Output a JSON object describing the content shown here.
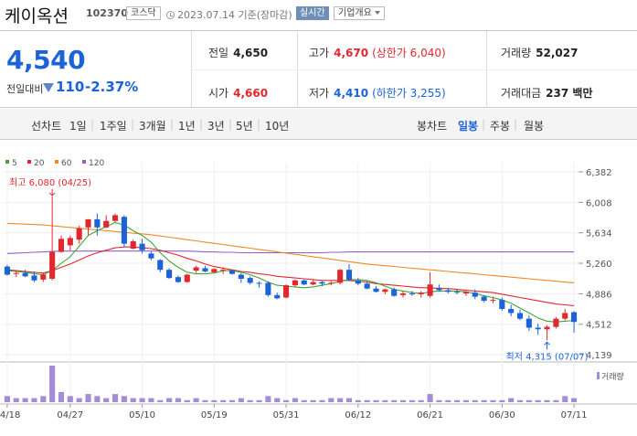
{
  "header": {
    "stock_name": "케이옥션",
    "stock_code": "102370",
    "market_badge": "코스닥",
    "as_of": "2023.07.14 기준(장마감)",
    "realtime_button": "실시간",
    "company_button": "기업개요"
  },
  "quote": {
    "current_price": "4,540",
    "change_label": "전일대비",
    "change_value": "110",
    "change_percent": "-2.37%",
    "prev_close": {
      "label": "전일",
      "value": "4,650"
    },
    "open": {
      "label": "시가",
      "value": "4,660"
    },
    "high": {
      "label": "고가",
      "value": "4,670",
      "limit_text": "(상한가 6,040)"
    },
    "low": {
      "label": "저가",
      "value": "4,410",
      "limit_text": "(하한가 3,255)"
    },
    "volume": {
      "label": "거래량",
      "value": "52,027"
    },
    "trade_value": {
      "label": "거래대금",
      "value": "237 백만"
    }
  },
  "period_bar": {
    "line_chart_label": "선차트",
    "line_periods": [
      "1일",
      "1주일",
      "3개월",
      "1년",
      "3년",
      "5년",
      "10년"
    ],
    "candle_chart_label": "봉차트",
    "candle_periods": [
      "일봉",
      "주봉",
      "월봉"
    ],
    "selected_candle_period": "일봉"
  },
  "colors": {
    "up": "#e0282e",
    "down": "#1b63d6",
    "ma5": "#3fa535",
    "ma20": "#e0282e",
    "ma60": "#f08a24",
    "ma120": "#9b59d0",
    "volume": "#a38cd8"
  },
  "chart_data": {
    "type": "candlestick",
    "legend": [
      {
        "name": "5",
        "color": "#3fa535"
      },
      {
        "name": "20",
        "color": "#e0282e"
      },
      {
        "name": "60",
        "color": "#f08a24"
      },
      {
        "name": "120",
        "color": "#9b59d0"
      }
    ],
    "volume_legend": "거래량",
    "y_ticks": [
      "6,382",
      "6,008",
      "5,634",
      "5,260",
      "4,886",
      "4,512",
      "4,139"
    ],
    "y_tick_values": [
      6382,
      6008,
      5634,
      5260,
      4886,
      4512,
      4139
    ],
    "ylim": [
      4139,
      6382
    ],
    "x_ticks": [
      "04/18",
      "04/27",
      "05/10",
      "05/19",
      "05/31",
      "06/12",
      "06/21",
      "06/30",
      "07/11"
    ],
    "x_tick_index": [
      0,
      7,
      15,
      23,
      31,
      39,
      47,
      55,
      63
    ],
    "annotations": {
      "high": {
        "text": "최고 6,080 (04/25)",
        "index": 5,
        "value": 6080
      },
      "low": {
        "text": "최저 4,315 (07/07)",
        "index": 60,
        "value": 4315
      }
    },
    "candles": [
      [
        5220,
        5240,
        5110,
        5120
      ],
      [
        5130,
        5170,
        5090,
        5140
      ],
      [
        5140,
        5180,
        5090,
        5100
      ],
      [
        5110,
        5160,
        5030,
        5050
      ],
      [
        5060,
        5140,
        5030,
        5120
      ],
      [
        5070,
        6080,
        5050,
        5400
      ],
      [
        5400,
        5600,
        5390,
        5560
      ],
      [
        5480,
        5600,
        5420,
        5570
      ],
      [
        5550,
        5720,
        5500,
        5690
      ],
      [
        5700,
        5800,
        5600,
        5800
      ],
      [
        5800,
        5870,
        5600,
        5700
      ],
      [
        5700,
        5850,
        5690,
        5780
      ],
      [
        5780,
        5870,
        5760,
        5850
      ],
      [
        5830,
        5850,
        5460,
        5500
      ],
      [
        5440,
        5550,
        5430,
        5530
      ],
      [
        5500,
        5560,
        5380,
        5420
      ],
      [
        5380,
        5400,
        5300,
        5320
      ],
      [
        5300,
        5310,
        5150,
        5180
      ],
      [
        5180,
        5200,
        5070,
        5080
      ],
      [
        5090,
        5110,
        5020,
        5030
      ],
      [
        5030,
        5130,
        5020,
        5120
      ],
      [
        5170,
        5230,
        5140,
        5210
      ],
      [
        5200,
        5230,
        5150,
        5160
      ],
      [
        5150,
        5200,
        5140,
        5190
      ],
      [
        5180,
        5210,
        5130,
        5180
      ],
      [
        5170,
        5180,
        5120,
        5130
      ],
      [
        5120,
        5140,
        5020,
        5070
      ],
      [
        5080,
        5100,
        5000,
        5020
      ],
      [
        5020,
        5040,
        4960,
        5010
      ],
      [
        5020,
        5040,
        4850,
        4870
      ],
      [
        4870,
        4900,
        4820,
        4830
      ],
      [
        4840,
        5000,
        4830,
        4990
      ],
      [
        4990,
        5060,
        4970,
        5050
      ],
      [
        5050,
        5060,
        4990,
        5000
      ],
      [
        5000,
        5060,
        4990,
        5030
      ],
      [
        5030,
        5040,
        4980,
        5010
      ],
      [
        5010,
        5040,
        4990,
        5020
      ],
      [
        5020,
        5190,
        5000,
        5180
      ],
      [
        5180,
        5250,
        5040,
        5060
      ],
      [
        5050,
        5080,
        4990,
        5010
      ],
      [
        5010,
        5040,
        4940,
        4950
      ],
      [
        4950,
        4980,
        4900,
        4910
      ],
      [
        4910,
        4950,
        4880,
        4940
      ],
      [
        4940,
        4960,
        4850,
        4860
      ],
      [
        4870,
        4920,
        4840,
        4890
      ],
      [
        4890,
        4920,
        4860,
        4880
      ],
      [
        4880,
        4920,
        4840,
        4900
      ],
      [
        4860,
        5150,
        4840,
        5000
      ],
      [
        4960,
        5000,
        4920,
        4930
      ],
      [
        4930,
        4960,
        4890,
        4910
      ],
      [
        4910,
        4940,
        4880,
        4900
      ],
      [
        4890,
        4920,
        4860,
        4910
      ],
      [
        4900,
        4940,
        4820,
        4850
      ],
      [
        4850,
        4870,
        4780,
        4800
      ],
      [
        4800,
        4850,
        4770,
        4810
      ],
      [
        4810,
        4840,
        4680,
        4700
      ],
      [
        4700,
        4750,
        4610,
        4650
      ],
      [
        4650,
        4690,
        4560,
        4580
      ],
      [
        4580,
        4620,
        4430,
        4470
      ],
      [
        4470,
        4520,
        4380,
        4450
      ],
      [
        4450,
        4500,
        4315,
        4480
      ],
      [
        4480,
        4600,
        4460,
        4580
      ],
      [
        4580,
        4700,
        4560,
        4650
      ],
      [
        4660,
        4670,
        4410,
        4540
      ]
    ],
    "ma5": [
      5170,
      5160,
      5150,
      5130,
      5120,
      5170,
      5260,
      5340,
      5470,
      5600,
      5660,
      5710,
      5760,
      5730,
      5660,
      5600,
      5520,
      5390,
      5290,
      5210,
      5150,
      5130,
      5130,
      5140,
      5170,
      5170,
      5150,
      5120,
      5080,
      5030,
      4990,
      4980,
      4970,
      4960,
      4970,
      4990,
      5010,
      5040,
      5060,
      5060,
      5050,
      5020,
      4980,
      4940,
      4920,
      4900,
      4890,
      4910,
      4920,
      4920,
      4920,
      4910,
      4890,
      4860,
      4840,
      4810,
      4770,
      4710,
      4650,
      4590,
      4550,
      4540,
      4550,
      4560
    ],
    "ma20": [
      5180,
      5170,
      5160,
      5150,
      5140,
      5170,
      5210,
      5250,
      5300,
      5350,
      5390,
      5420,
      5450,
      5460,
      5460,
      5450,
      5440,
      5420,
      5390,
      5360,
      5320,
      5290,
      5250,
      5220,
      5200,
      5180,
      5160,
      5150,
      5130,
      5120,
      5100,
      5090,
      5080,
      5070,
      5060,
      5050,
      5050,
      5050,
      5050,
      5040,
      5030,
      5010,
      5000,
      4990,
      4980,
      4970,
      4960,
      4960,
      4950,
      4950,
      4940,
      4930,
      4920,
      4910,
      4900,
      4880,
      4860,
      4840,
      4820,
      4800,
      4780,
      4760,
      4750,
      4740
    ],
    "ma60": [
      5750,
      5745,
      5740,
      5735,
      5730,
      5720,
      5710,
      5700,
      5690,
      5680,
      5670,
      5660,
      5650,
      5640,
      5630,
      5620,
      5610,
      5595,
      5580,
      5565,
      5550,
      5535,
      5520,
      5505,
      5490,
      5475,
      5460,
      5445,
      5430,
      5415,
      5400,
      5385,
      5370,
      5355,
      5340,
      5325,
      5310,
      5295,
      5280,
      5265,
      5250,
      5240,
      5230,
      5220,
      5210,
      5200,
      5190,
      5180,
      5170,
      5160,
      5150,
      5140,
      5130,
      5120,
      5110,
      5100,
      5090,
      5080,
      5070,
      5060,
      5050,
      5040,
      5030,
      5020
    ],
    "ma120": [
      5380,
      5385,
      5390,
      5395,
      5400,
      5405,
      5410,
      5410,
      5410,
      5410,
      5410,
      5410,
      5410,
      5410,
      5410,
      5410,
      5410,
      5410,
      5410,
      5410,
      5410,
      5405,
      5400,
      5400,
      5395,
      5395,
      5390,
      5390,
      5390,
      5390,
      5390,
      5390,
      5390,
      5390,
      5390,
      5390,
      5395,
      5395,
      5400,
      5400,
      5400,
      5400,
      5400,
      5400,
      5400,
      5400,
      5400,
      5400,
      5400,
      5400,
      5400,
      5400,
      5400,
      5400,
      5400,
      5400,
      5400,
      5400,
      5400,
      5400,
      5400,
      5400,
      5400,
      5400
    ],
    "volume": [
      3,
      2,
      2,
      2,
      3,
      18,
      5,
      3,
      2,
      4,
      3,
      2,
      4,
      3,
      2,
      2,
      2,
      1,
      2,
      2,
      1,
      2,
      1,
      1,
      1,
      1,
      2,
      1,
      1,
      3,
      2,
      1,
      2,
      1,
      1,
      1,
      2,
      2,
      2,
      1,
      1,
      1,
      1,
      1,
      1,
      1,
      1,
      4,
      1,
      1,
      1,
      1,
      1,
      1,
      1,
      1,
      2,
      1,
      1,
      1,
      1,
      1,
      3,
      2
    ]
  }
}
